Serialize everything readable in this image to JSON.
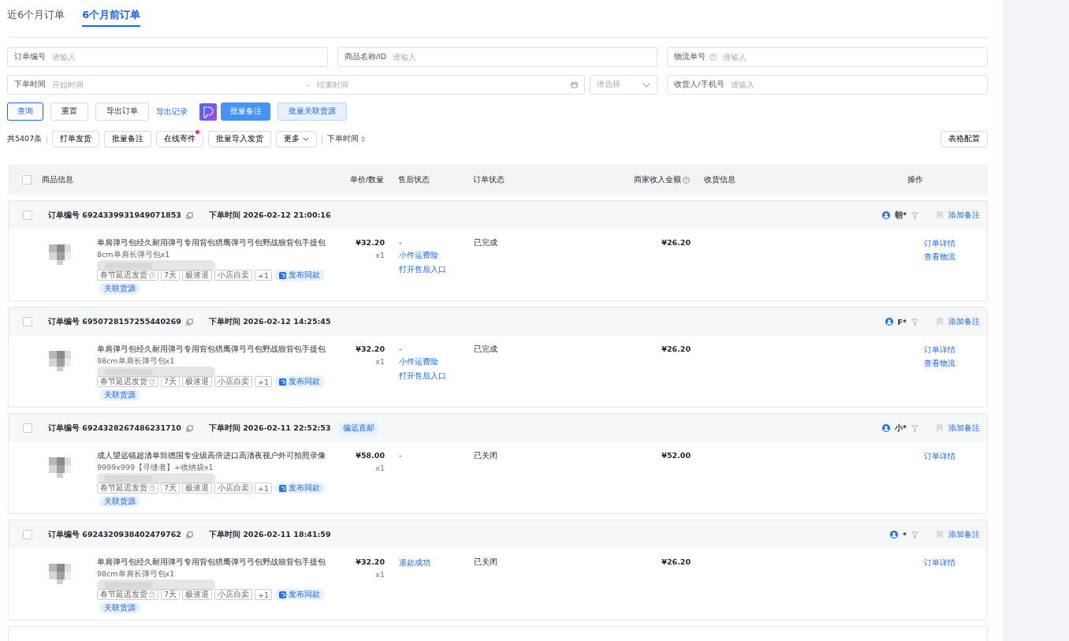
{
  "tabs": [
    {
      "label": "近6个月订单",
      "selected": false
    },
    {
      "label": "6个月前订单",
      "selected": true
    }
  ],
  "filters": [
    {
      "kind": "text",
      "label": "订单编号",
      "help": false,
      "placeholder": "请输入"
    },
    {
      "kind": "text",
      "label": "商品名称/ID",
      "help": false,
      "placeholder": "请输入"
    },
    {
      "kind": "text",
      "label": "物流单号",
      "help": true,
      "placeholder": "请输入"
    },
    {
      "kind": "daterange",
      "label": "下单时间",
      "start_placeholder": "开始时间",
      "separator": "–",
      "end_placeholder": "结束时间",
      "select_placeholder": "请选择"
    },
    {
      "kind": "text",
      "label": "收货人/手机号",
      "help": false,
      "placeholder": "请输入"
    }
  ],
  "actions": [
    {
      "kind": "outline",
      "label": "查询"
    },
    {
      "kind": "default",
      "label": "重置"
    },
    {
      "kind": "default",
      "label": "导出订单"
    },
    {
      "kind": "link",
      "label": "导出记录"
    },
    {
      "kind": "app"
    },
    {
      "kind": "primary",
      "label": "批量备注"
    },
    {
      "kind": "light",
      "label": "批量关联货源"
    }
  ],
  "toolbar": {
    "count": "共5407条",
    "buttons": [
      {
        "label": "打单发货",
        "dot": false,
        "dropdown": false
      },
      {
        "label": "批量备注",
        "dot": false,
        "dropdown": false
      },
      {
        "label": "在线寄件",
        "dot": true,
        "dropdown": false
      },
      {
        "label": "批量导入发货",
        "dot": false,
        "dropdown": false
      },
      {
        "label": "更多",
        "dot": false,
        "dropdown": true
      }
    ],
    "sort": "下单时间",
    "config": "表格配置"
  },
  "table": {
    "checked": false,
    "columns": [
      {
        "label": "商品信息",
        "help": false
      },
      {
        "label": "单价/数量",
        "help": false
      },
      {
        "label": "售后状态",
        "help": false
      },
      {
        "label": "订单状态",
        "help": false
      },
      {
        "label": "商家收入金额",
        "help": true
      },
      {
        "label": "收货信息",
        "help": false
      },
      {
        "label": "操作",
        "help": false
      }
    ]
  },
  "orders": [
    {
      "checked": false,
      "id_label": "订单编号",
      "id": "6924339931949071853",
      "time_label": "下单时间",
      "time": "2026-02-12 21:00:16",
      "buyer": "朝*",
      "note": "添加备注",
      "title": "单肩弹弓包经久耐用弹弓专用背包猎鹰弹弓弓包野战狼背包手提包",
      "sku": "8cm单肩长弹弓包x1",
      "tags": [
        {
          "label": "春节延迟发货",
          "help": true
        },
        {
          "label": "7天",
          "help": false
        },
        {
          "label": "极速退",
          "help": false
        },
        {
          "label": "小店自卖",
          "help": false
        },
        {
          "label": "+1",
          "help": false
        }
      ],
      "publish": "发布同款",
      "source": "关联货源",
      "price": "¥32.20",
      "qty": "x1",
      "after_sale": [
        {
          "kind": "text",
          "label": "-"
        },
        {
          "kind": "link",
          "label": "小件运费险"
        },
        {
          "kind": "link",
          "label": "打开售后入口"
        }
      ],
      "status": "已完成",
      "income": "¥26.20",
      "ops": [
        "订单详情",
        "查看物流"
      ]
    },
    {
      "checked": false,
      "id_label": "订单编号",
      "id": "6950728157255440269",
      "time_label": "下单时间",
      "time": "2026-02-12 14:25:45",
      "buyer": "F*",
      "note": "添加备注",
      "title": "单肩弹弓包经久耐用弹弓专用背包猎鹰弹弓弓包野战狼背包手提包",
      "sku": "98cm单肩长弹弓包x1",
      "tags": [
        {
          "label": "春节延迟发货",
          "help": true
        },
        {
          "label": "7天",
          "help": false
        },
        {
          "label": "极速退",
          "help": false
        },
        {
          "label": "小店自卖",
          "help": false
        },
        {
          "label": "+1",
          "help": false
        }
      ],
      "publish": "发布同款",
      "source": "关联货源",
      "price": "¥32.20",
      "qty": "x1",
      "after_sale": [
        {
          "kind": "text",
          "label": "-"
        },
        {
          "kind": "link",
          "label": "小件运费险"
        },
        {
          "kind": "link",
          "label": "打开售后入口"
        }
      ],
      "status": "已完成",
      "income": "¥26.20",
      "ops": [
        "订单详情",
        "查看物流"
      ]
    },
    {
      "checked": false,
      "id_label": "订单编号",
      "id": "6924328267486231710",
      "time_label": "下单时间",
      "time": "2026-02-11 22:52:53",
      "badge": "偏远直邮",
      "buyer": "小*",
      "note": "添加备注",
      "title": "成人望远镜超清单筒德国专业级高倍进口高清夜视户外可拍照录像",
      "sku": "9999x999【寻缝者】+收纳袋x1",
      "tags": [
        {
          "label": "春节延迟发货",
          "help": true
        },
        {
          "label": "7天",
          "help": false
        },
        {
          "label": "极速退",
          "help": false
        },
        {
          "label": "小店自卖",
          "help": false
        },
        {
          "label": "+1",
          "help": false
        }
      ],
      "publish": "发布同款",
      "source": "关联货源",
      "price": "¥58.00",
      "qty": "x1",
      "after_sale": [
        {
          "kind": "text",
          "label": "-"
        }
      ],
      "status": "已关闭",
      "income": "¥52.00",
      "ops": [
        "订单详情"
      ]
    },
    {
      "checked": false,
      "id_label": "订单编号",
      "id": "6924320938402479762",
      "time_label": "下单时间",
      "time": "2026-02-11 18:41:59",
      "buyer": "*",
      "note": "添加备注",
      "title": "单肩弹弓包经久耐用弹弓专用背包猎鹰弹弓弓包野战狼背包手提包",
      "sku": "98cm单肩长弹弓包x1",
      "tags": [
        {
          "label": "春节延迟发货",
          "help": true
        },
        {
          "label": "7天",
          "help": false
        },
        {
          "label": "极速退",
          "help": false
        },
        {
          "label": "小店自卖",
          "help": false
        },
        {
          "label": "+1",
          "help": false
        }
      ],
      "publish": "发布同款",
      "source": "关联货源",
      "price": "¥32.20",
      "qty": "x1",
      "after_sale": [
        {
          "kind": "link",
          "label": "退款成功"
        }
      ],
      "status": "已关闭",
      "income": "¥26.20",
      "ops": [
        "订单详情"
      ]
    }
  ]
}
